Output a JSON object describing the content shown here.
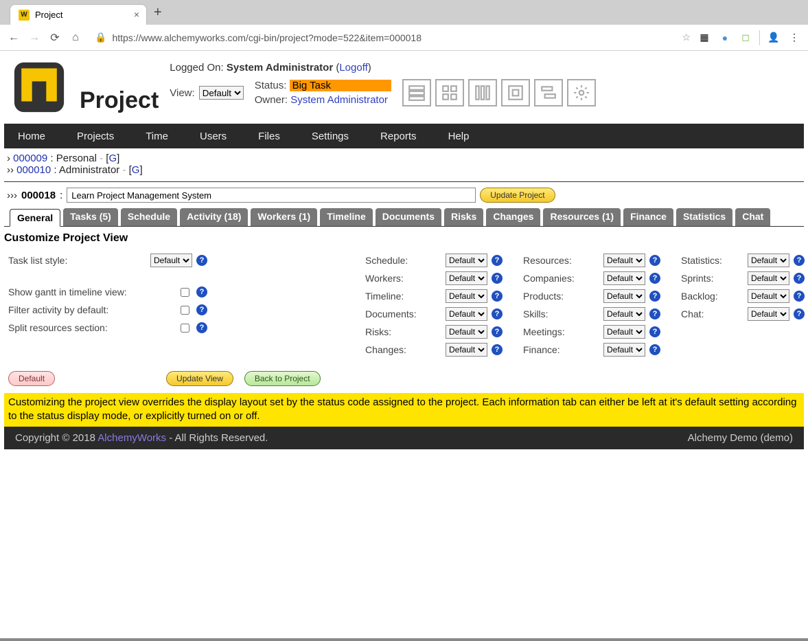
{
  "window": {
    "tab_title": "Project",
    "url": "https://www.alchemyworks.com/cgi-bin/project?mode=522&item=000018"
  },
  "header": {
    "app_title": "Project",
    "logged_on_label": "Logged On:",
    "logged_on_user": "System Administrator",
    "logoff_label": "Logoff",
    "view_label": "View:",
    "view_value": "Default",
    "status_label": "Status:",
    "status_value": "Big Task",
    "owner_label": "Owner:",
    "owner_value": "System Administrator"
  },
  "nav": {
    "items": [
      "Home",
      "Projects",
      "Time",
      "Users",
      "Files",
      "Settings",
      "Reports",
      "Help"
    ]
  },
  "breadcrumbs": {
    "l1_prefix": "›",
    "l1_id": "000009",
    "l1_sep": " : ",
    "l1_name": "Personal",
    "l1_g": "G",
    "l2_prefix": "››",
    "l2_id": "000010",
    "l2_sep": " : ",
    "l2_name": "Administrator",
    "l2_g": "G"
  },
  "project": {
    "prefix": "›››",
    "id": "000018",
    "sep": ":",
    "name": "Learn Project Management System",
    "update_label": "Update Project"
  },
  "tabs": {
    "items": [
      "General",
      "Tasks (5)",
      "Schedule",
      "Activity (18)",
      "Workers (1)",
      "Timeline",
      "Documents",
      "Risks",
      "Changes",
      "Resources (1)",
      "Finance",
      "Statistics",
      "Chat"
    ],
    "active_index": 0
  },
  "customize": {
    "heading": "Customize Project View",
    "task_list_style_label": "Task list style:",
    "task_list_style_value": "Default",
    "show_gantt_label": "Show gantt in timeline view:",
    "filter_activity_label": "Filter activity by default:",
    "split_resources_label": "Split resources section:",
    "col2": {
      "schedule": {
        "label": "Schedule:",
        "value": "Default"
      },
      "workers": {
        "label": "Workers:",
        "value": "Default"
      },
      "timeline": {
        "label": "Timeline:",
        "value": "Default"
      },
      "documents": {
        "label": "Documents:",
        "value": "Default"
      },
      "risks": {
        "label": "Risks:",
        "value": "Default"
      },
      "changes": {
        "label": "Changes:",
        "value": "Default"
      }
    },
    "col3": {
      "resources": {
        "label": "Resources:",
        "value": "Default"
      },
      "companies": {
        "label": "Companies:",
        "value": "Default"
      },
      "products": {
        "label": "Products:",
        "value": "Default"
      },
      "skills": {
        "label": "Skills:",
        "value": "Default"
      },
      "meetings": {
        "label": "Meetings:",
        "value": "Default"
      },
      "finance": {
        "label": "Finance:",
        "value": "Default"
      }
    },
    "col4": {
      "statistics": {
        "label": "Statistics:",
        "value": "Default"
      },
      "sprints": {
        "label": "Sprints:",
        "value": "Default"
      },
      "backlog": {
        "label": "Backlog:",
        "value": "Default"
      },
      "chat": {
        "label": "Chat:",
        "value": "Default"
      }
    },
    "buttons": {
      "default": "Default",
      "update_view": "Update View",
      "back": "Back to Project"
    },
    "notice": "Customizing the project view overrides the display layout set by the status code assigned to the project. Each information tab can either be left at it's default setting according to the status display mode, or explicitly turned on or off."
  },
  "footer": {
    "left_prefix": "Copyright © 2018 ",
    "left_link": "AlchemyWorks",
    "left_suffix": " - All Rights Reserved.",
    "right": "Alchemy Demo (demo)"
  }
}
